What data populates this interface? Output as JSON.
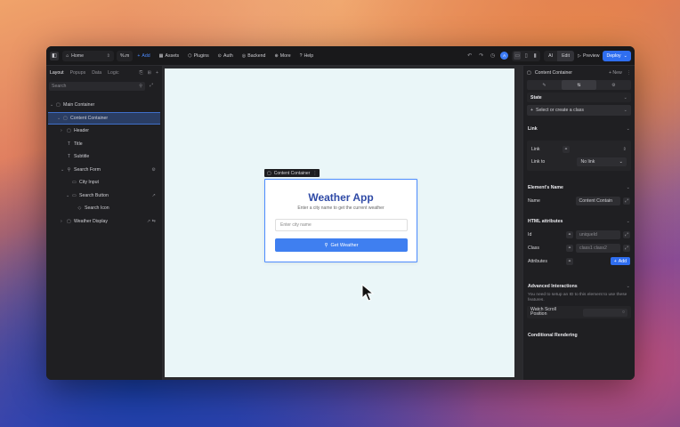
{
  "toolbar": {
    "home_label": "Home",
    "zoom": "%.m",
    "add": "Add",
    "assets": "Assets",
    "plugins": "Plugins",
    "auth": "Auth",
    "backend": "Backend",
    "more": "More",
    "help": "Help",
    "ai": "AI",
    "edit": "Edit",
    "preview": "Preview",
    "deploy": "Deploy"
  },
  "left_panel": {
    "tabs": [
      "Layout",
      "Popups",
      "Data",
      "Logic"
    ],
    "search_placeholder": "Search",
    "tree": [
      {
        "label": "Main Container",
        "depth": 0,
        "icon": "▢",
        "toggle": "⌄"
      },
      {
        "label": "Content Container",
        "depth": 1,
        "icon": "▢",
        "toggle": "⌄",
        "selected": true
      },
      {
        "label": "Header",
        "depth": 2,
        "icon": "▢",
        "toggle": "›"
      },
      {
        "label": "Title",
        "depth": 2,
        "icon": "T",
        "toggle": ""
      },
      {
        "label": "Subtitle",
        "depth": 2,
        "icon": "T",
        "toggle": ""
      },
      {
        "label": "Search Form",
        "depth": 2,
        "icon": "⚲",
        "toggle": "⌄",
        "badge": "⚙"
      },
      {
        "label": "City Input",
        "depth": 3,
        "icon": "▭",
        "toggle": ""
      },
      {
        "label": "Search Button",
        "depth": 3,
        "icon": "▭",
        "toggle": "⌄",
        "badge": "↗"
      },
      {
        "label": "Search Icon",
        "depth": 4,
        "icon": "◇",
        "toggle": ""
      },
      {
        "label": "Weather Display",
        "depth": 2,
        "icon": "▢",
        "toggle": "›",
        "badge": "↗ ⇆"
      }
    ]
  },
  "canvas": {
    "selection_label": "Content Container",
    "card": {
      "title": "Weather App",
      "subtitle": "Enter a city name to get the current weather",
      "input_placeholder": "Enter city name",
      "button_label": "Get Weather"
    }
  },
  "right_panel": {
    "element_title": "Content Container",
    "new_label": "New",
    "state_label": "State",
    "class_select": "Select or create a class",
    "link_section": "Link",
    "link_label": "Link",
    "link_to_label": "Link to",
    "link_to_value": "No link",
    "element_name_section": "Element's Name",
    "name_label": "Name",
    "name_value": "Content Contain",
    "html_attr_section": "HTML attributes",
    "id_label": "Id",
    "id_placeholder": "uniqueId",
    "class_label": "Class",
    "class_placeholder": "class1 class2",
    "attributes_label": "Attributes",
    "add_label": "Add",
    "advanced_section": "Advanced Interactions",
    "advanced_note": "You need to setup an ID to this element to use these features.",
    "watch_scroll": "Watch Scroll Position",
    "conditional_section": "Conditional Rendering"
  }
}
